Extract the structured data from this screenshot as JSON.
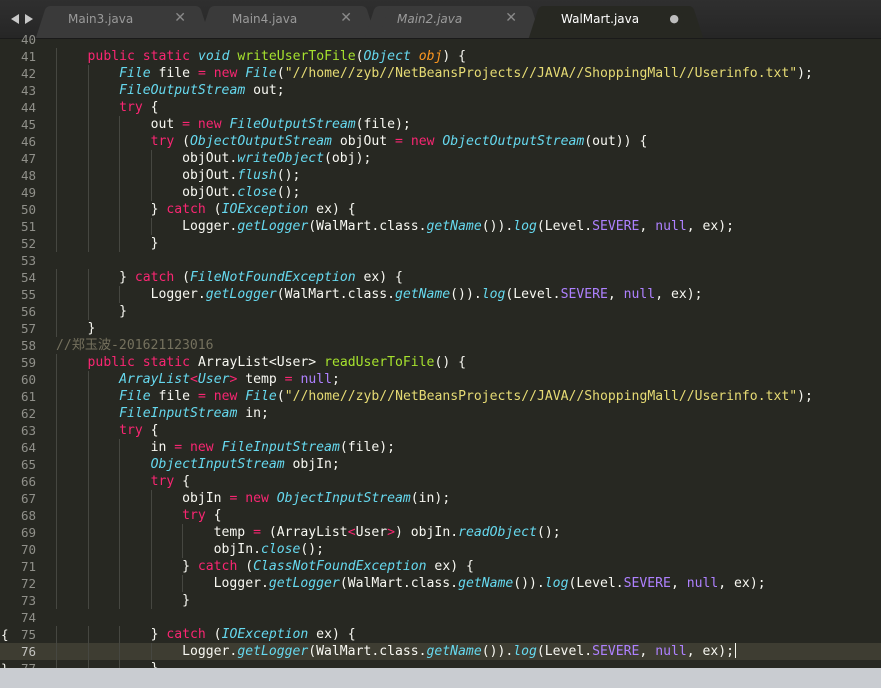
{
  "tabs": [
    {
      "label": "Main3.java",
      "close": "✕",
      "active": false,
      "italic": false
    },
    {
      "label": "Main4.java",
      "close": "✕",
      "active": false,
      "italic": false
    },
    {
      "label": "Main2.java",
      "close": "✕",
      "active": false,
      "italic": true
    },
    {
      "label": "WalMart.java",
      "close": "●",
      "active": true,
      "italic": false
    }
  ],
  "current_line": 76,
  "theme": {
    "background": "#272822",
    "keyword": "#f92672",
    "type": "#66d9ef",
    "function": "#a6e22e",
    "string": "#e6db74",
    "constant": "#ae81ff",
    "comment": "#75715e"
  },
  "lines": [
    {
      "n": "40",
      "fold": "",
      "tokens": []
    },
    {
      "n": "41",
      "fold": "",
      "tokens": [
        [
          "",
          "    "
        ],
        [
          "kw",
          "public"
        ],
        [
          "",
          " "
        ],
        [
          "kw",
          "static"
        ],
        [
          "",
          " "
        ],
        [
          "st",
          "void"
        ],
        [
          "",
          " "
        ],
        [
          "fn",
          "writeUserToFile"
        ],
        [
          "",
          "("
        ],
        [
          "ty",
          "Object"
        ],
        [
          "",
          " "
        ],
        [
          "pa",
          "obj"
        ],
        [
          "",
          ") {"
        ]
      ]
    },
    {
      "n": "42",
      "fold": "",
      "tokens": [
        [
          "",
          "        "
        ],
        [
          "ty",
          "File"
        ],
        [
          "",
          " file "
        ],
        [
          "kw",
          "="
        ],
        [
          "",
          " "
        ],
        [
          "kw",
          "new"
        ],
        [
          "",
          " "
        ],
        [
          "ty",
          "File"
        ],
        [
          "",
          "("
        ],
        [
          "str",
          "\"//home//zyb//NetBeansProjects//JAVA//ShoppingMall//Userinfo.txt\""
        ],
        [
          "",
          ");"
        ]
      ]
    },
    {
      "n": "43",
      "fold": "",
      "tokens": [
        [
          "",
          "        "
        ],
        [
          "ty",
          "FileOutputStream"
        ],
        [
          "",
          " out;"
        ]
      ]
    },
    {
      "n": "44",
      "fold": "",
      "tokens": [
        [
          "",
          "        "
        ],
        [
          "kw",
          "try"
        ],
        [
          "",
          " {"
        ]
      ]
    },
    {
      "n": "45",
      "fold": "",
      "tokens": [
        [
          "",
          "            out "
        ],
        [
          "kw",
          "="
        ],
        [
          "",
          " "
        ],
        [
          "kw",
          "new"
        ],
        [
          "",
          " "
        ],
        [
          "ty",
          "FileOutputStream"
        ],
        [
          "",
          "(file);"
        ]
      ]
    },
    {
      "n": "46",
      "fold": "",
      "tokens": [
        [
          "",
          "            "
        ],
        [
          "kw",
          "try"
        ],
        [
          "",
          " ("
        ],
        [
          "ty",
          "ObjectOutputStream"
        ],
        [
          "",
          " objOut "
        ],
        [
          "kw",
          "="
        ],
        [
          "",
          " "
        ],
        [
          "kw",
          "new"
        ],
        [
          "",
          " "
        ],
        [
          "ty",
          "ObjectOutputStream"
        ],
        [
          "",
          "(out)) {"
        ]
      ]
    },
    {
      "n": "47",
      "fold": "",
      "tokens": [
        [
          "",
          "                objOut."
        ],
        [
          "ty",
          "writeObject"
        ],
        [
          "",
          "(obj);"
        ]
      ]
    },
    {
      "n": "48",
      "fold": "",
      "tokens": [
        [
          "",
          "                objOut."
        ],
        [
          "ty",
          "flush"
        ],
        [
          "",
          "();"
        ]
      ]
    },
    {
      "n": "49",
      "fold": "",
      "tokens": [
        [
          "",
          "                objOut."
        ],
        [
          "ty",
          "close"
        ],
        [
          "",
          "();"
        ]
      ]
    },
    {
      "n": "50",
      "fold": "",
      "tokens": [
        [
          "",
          "            } "
        ],
        [
          "kw",
          "catch"
        ],
        [
          "",
          " ("
        ],
        [
          "ty",
          "IOException"
        ],
        [
          "",
          " ex) {"
        ]
      ]
    },
    {
      "n": "51",
      "fold": "",
      "tokens": [
        [
          "",
          "                Logger."
        ],
        [
          "ty",
          "getLogger"
        ],
        [
          "",
          "(WalMart.class."
        ],
        [
          "ty",
          "getName"
        ],
        [
          "",
          "())."
        ],
        [
          "ty",
          "log"
        ],
        [
          "",
          "(Level."
        ],
        [
          "cn",
          "SEVERE"
        ],
        [
          "",
          ", "
        ],
        [
          "cn",
          "null"
        ],
        [
          "",
          ", ex);"
        ]
      ]
    },
    {
      "n": "52",
      "fold": "",
      "tokens": [
        [
          "",
          "            }"
        ]
      ]
    },
    {
      "n": "53",
      "fold": "",
      "tokens": []
    },
    {
      "n": "54",
      "fold": "",
      "tokens": [
        [
          "",
          "        } "
        ],
        [
          "kw",
          "catch"
        ],
        [
          "",
          " ("
        ],
        [
          "ty",
          "FileNotFoundException"
        ],
        [
          "",
          " ex) {"
        ]
      ]
    },
    {
      "n": "55",
      "fold": "",
      "tokens": [
        [
          "",
          "            Logger."
        ],
        [
          "ty",
          "getLogger"
        ],
        [
          "",
          "(WalMart.class."
        ],
        [
          "ty",
          "getName"
        ],
        [
          "",
          "())."
        ],
        [
          "ty",
          "log"
        ],
        [
          "",
          "(Level."
        ],
        [
          "cn",
          "SEVERE"
        ],
        [
          "",
          ", "
        ],
        [
          "cn",
          "null"
        ],
        [
          "",
          ", ex);"
        ]
      ]
    },
    {
      "n": "56",
      "fold": "",
      "tokens": [
        [
          "",
          "        }"
        ]
      ]
    },
    {
      "n": "57",
      "fold": "",
      "tokens": [
        [
          "",
          "    }"
        ]
      ]
    },
    {
      "n": "58",
      "fold": "",
      "tokens": [
        [
          "cm",
          "//郑玉波-201621123016"
        ]
      ]
    },
    {
      "n": "59",
      "fold": "",
      "tokens": [
        [
          "",
          "    "
        ],
        [
          "kw",
          "public"
        ],
        [
          "",
          " "
        ],
        [
          "kw",
          "static"
        ],
        [
          "",
          " ArrayList<User> "
        ],
        [
          "fn",
          "readUserToFile"
        ],
        [
          "",
          "() {"
        ]
      ]
    },
    {
      "n": "60",
      "fold": "",
      "tokens": [
        [
          "",
          "        "
        ],
        [
          "ty",
          "ArrayList"
        ],
        [
          "kw",
          "<"
        ],
        [
          "ty",
          "User"
        ],
        [
          "kw",
          ">"
        ],
        [
          "",
          " temp "
        ],
        [
          "kw",
          "="
        ],
        [
          "",
          " "
        ],
        [
          "cn",
          "null"
        ],
        [
          "",
          ";"
        ]
      ]
    },
    {
      "n": "61",
      "fold": "",
      "tokens": [
        [
          "",
          "        "
        ],
        [
          "ty",
          "File"
        ],
        [
          "",
          " file "
        ],
        [
          "kw",
          "="
        ],
        [
          "",
          " "
        ],
        [
          "kw",
          "new"
        ],
        [
          "",
          " "
        ],
        [
          "ty",
          "File"
        ],
        [
          "",
          "("
        ],
        [
          "str",
          "\"//home//zyb//NetBeansProjects//JAVA//ShoppingMall//Userinfo.txt\""
        ],
        [
          "",
          ");"
        ]
      ]
    },
    {
      "n": "62",
      "fold": "",
      "tokens": [
        [
          "",
          "        "
        ],
        [
          "ty",
          "FileInputStream"
        ],
        [
          "",
          " in;"
        ]
      ]
    },
    {
      "n": "63",
      "fold": "",
      "tokens": [
        [
          "",
          "        "
        ],
        [
          "kw",
          "try"
        ],
        [
          "",
          " {"
        ]
      ]
    },
    {
      "n": "64",
      "fold": "",
      "tokens": [
        [
          "",
          "            in "
        ],
        [
          "kw",
          "="
        ],
        [
          "",
          " "
        ],
        [
          "kw",
          "new"
        ],
        [
          "",
          " "
        ],
        [
          "ty",
          "FileInputStream"
        ],
        [
          "",
          "(file);"
        ]
      ]
    },
    {
      "n": "65",
      "fold": "",
      "tokens": [
        [
          "",
          "            "
        ],
        [
          "ty",
          "ObjectInputStream"
        ],
        [
          "",
          " objIn;"
        ]
      ]
    },
    {
      "n": "66",
      "fold": "",
      "tokens": [
        [
          "",
          "            "
        ],
        [
          "kw",
          "try"
        ],
        [
          "",
          " {"
        ]
      ]
    },
    {
      "n": "67",
      "fold": "",
      "tokens": [
        [
          "",
          "                objIn "
        ],
        [
          "kw",
          "="
        ],
        [
          "",
          " "
        ],
        [
          "kw",
          "new"
        ],
        [
          "",
          " "
        ],
        [
          "ty",
          "ObjectInputStream"
        ],
        [
          "",
          "(in);"
        ]
      ]
    },
    {
      "n": "68",
      "fold": "",
      "tokens": [
        [
          "",
          "                "
        ],
        [
          "kw",
          "try"
        ],
        [
          "",
          " {"
        ]
      ]
    },
    {
      "n": "69",
      "fold": "",
      "tokens": [
        [
          "",
          "                    temp "
        ],
        [
          "kw",
          "="
        ],
        [
          "",
          " (ArrayList"
        ],
        [
          "kw",
          "<"
        ],
        [
          "",
          "User"
        ],
        [
          "kw",
          ">"
        ],
        [
          "",
          ") objIn."
        ],
        [
          "ty",
          "readObject"
        ],
        [
          "",
          "();"
        ]
      ]
    },
    {
      "n": "70",
      "fold": "",
      "tokens": [
        [
          "",
          "                    objIn."
        ],
        [
          "ty",
          "close"
        ],
        [
          "",
          "();"
        ]
      ]
    },
    {
      "n": "71",
      "fold": "",
      "tokens": [
        [
          "",
          "                } "
        ],
        [
          "kw",
          "catch"
        ],
        [
          "",
          " ("
        ],
        [
          "ty",
          "ClassNotFoundException"
        ],
        [
          "",
          " ex) {"
        ]
      ]
    },
    {
      "n": "72",
      "fold": "",
      "tokens": [
        [
          "",
          "                    Logger."
        ],
        [
          "ty",
          "getLogger"
        ],
        [
          "",
          "(WalMart.class."
        ],
        [
          "ty",
          "getName"
        ],
        [
          "",
          "())."
        ],
        [
          "ty",
          "log"
        ],
        [
          "",
          "(Level."
        ],
        [
          "cn",
          "SEVERE"
        ],
        [
          "",
          ", "
        ],
        [
          "cn",
          "null"
        ],
        [
          "",
          ", ex);"
        ]
      ]
    },
    {
      "n": "73",
      "fold": "",
      "tokens": [
        [
          "",
          "                }"
        ]
      ]
    },
    {
      "n": "74",
      "fold": "",
      "tokens": []
    },
    {
      "n": "75",
      "fold": "{",
      "tokens": [
        [
          "",
          "            } "
        ],
        [
          "kw",
          "catch"
        ],
        [
          "",
          " ("
        ],
        [
          "ty",
          "IOException"
        ],
        [
          "",
          " ex) {"
        ]
      ]
    },
    {
      "n": "76",
      "fold": "",
      "tokens": [
        [
          "",
          "                Logger."
        ],
        [
          "ty",
          "getLogger"
        ],
        [
          "",
          "(WalMart.class."
        ],
        [
          "ty",
          "getName"
        ],
        [
          "",
          "())."
        ],
        [
          "ty",
          "log"
        ],
        [
          "",
          "(Level."
        ],
        [
          "cn",
          "SEVERE"
        ],
        [
          "",
          ", "
        ],
        [
          "cn",
          "null"
        ],
        [
          "",
          ", ex);"
        ]
      ]
    },
    {
      "n": "77",
      "fold": "}",
      "tokens": [
        [
          "",
          "            }"
        ]
      ]
    }
  ]
}
